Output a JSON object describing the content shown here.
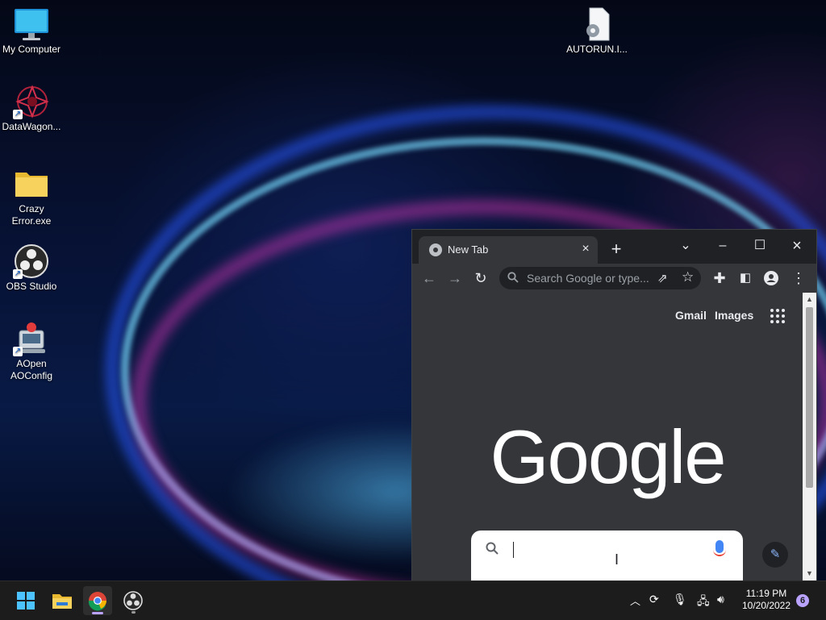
{
  "desktop": {
    "icons": [
      {
        "label": "My Computer",
        "icon": "monitor-icon"
      },
      {
        "label": "DataWagon...",
        "icon": "datawagon-app-icon"
      },
      {
        "label": "Crazy\nError.exe",
        "icon": "folder-icon"
      },
      {
        "label": "OBS Studio",
        "icon": "obs-icon"
      },
      {
        "label": "AOpen\nAOConfig",
        "icon": "aoconfig-icon"
      },
      {
        "label": "AUTORUN.I...",
        "icon": "settings-file-icon"
      }
    ]
  },
  "browser": {
    "tab_title": "New Tab",
    "omnibox_placeholder": "Search Google or type...",
    "page": {
      "links": {
        "gmail": "Gmail",
        "images": "Images"
      },
      "logo": "Google"
    }
  },
  "taskbar": {
    "apps": [
      "start-icon",
      "file-explorer-icon",
      "chrome-icon",
      "obs-icon"
    ],
    "clock": {
      "time": "11:19 PM",
      "date": "10/20/2022"
    },
    "notifications": "6"
  },
  "colors": {
    "accent": "#b9a3ff",
    "chrome_dark": "#202124",
    "chrome_toolbar": "#35363a"
  }
}
